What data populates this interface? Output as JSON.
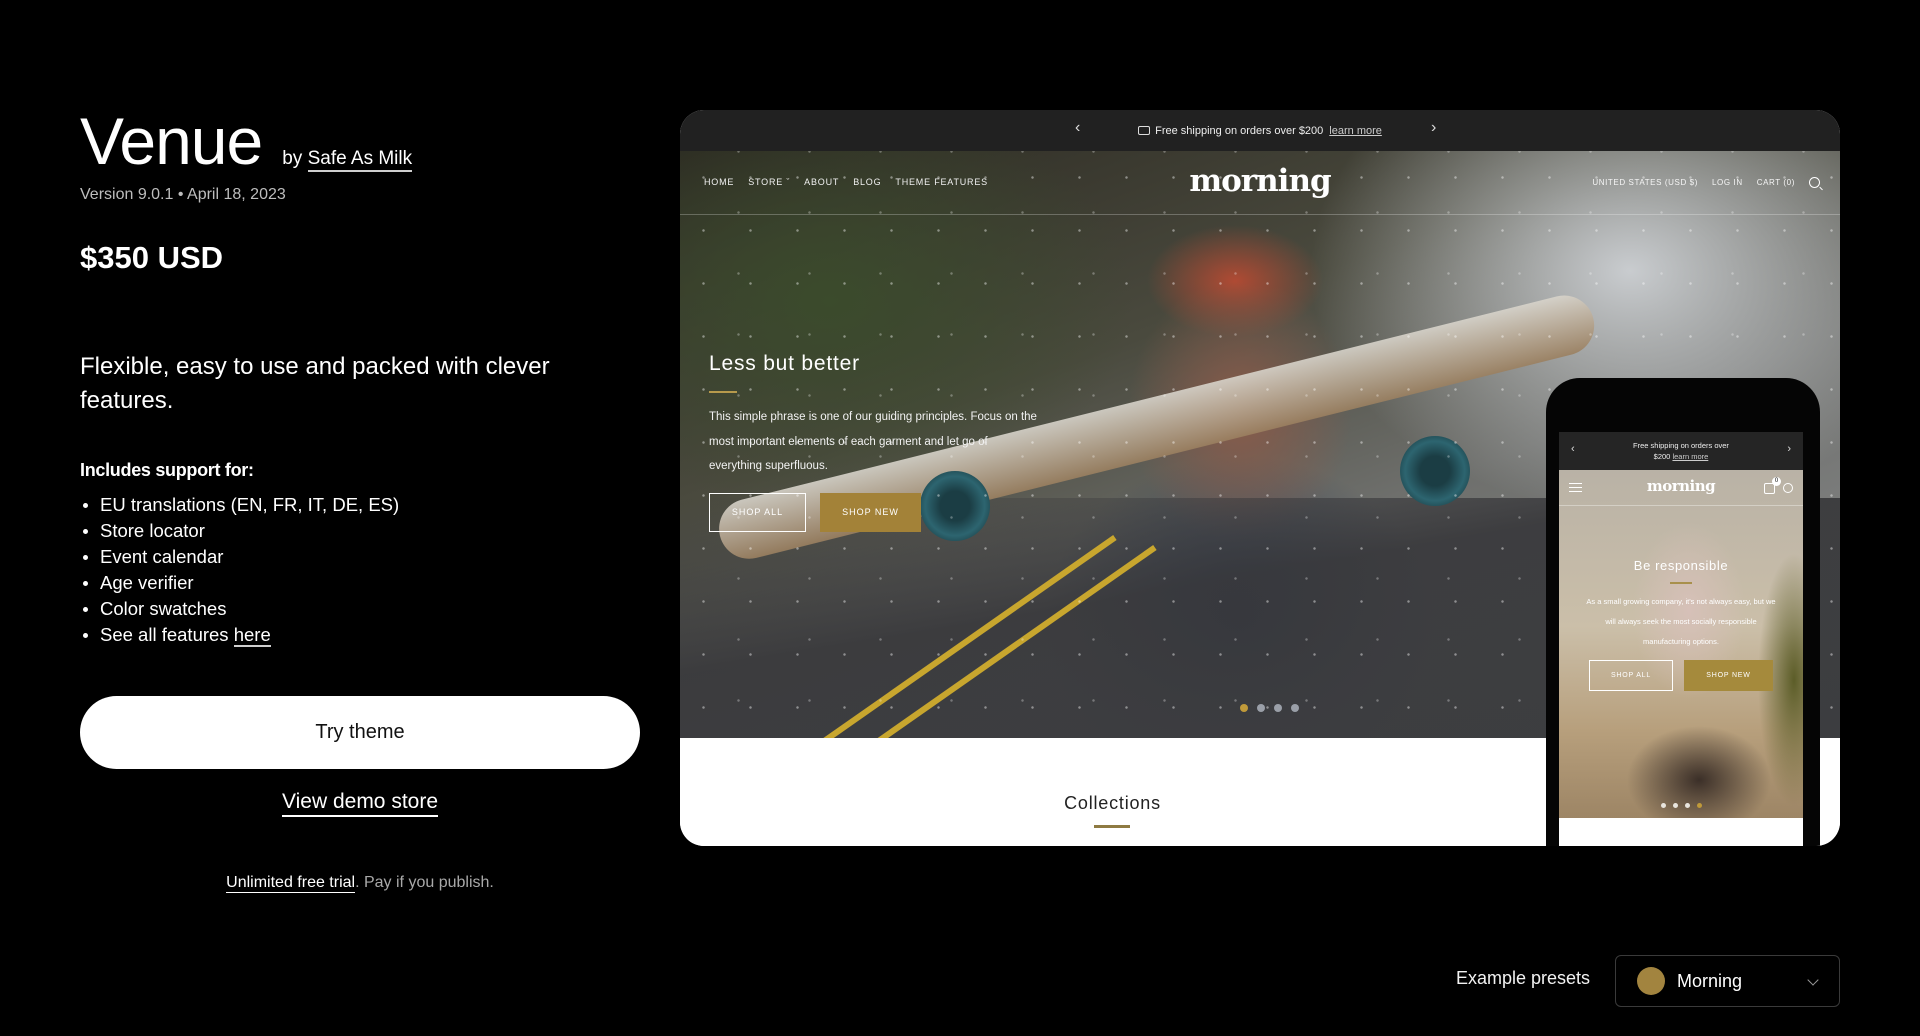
{
  "theme": {
    "name": "Venue",
    "by_prefix": "by",
    "author": "Safe As Milk",
    "version": "Version 9.0.1",
    "separator": "•",
    "date": "April 18, 2023",
    "price": "$350 USD",
    "tagline": "Flexible, easy to use and packed with clever features.",
    "includes_title": "Includes support for:",
    "features": [
      "EU translations (EN, FR, IT, DE, ES)",
      "Store locator",
      "Event calendar",
      "Age verifier",
      "Color swatches"
    ],
    "see_all_prefix": "See all features",
    "see_all_link": "here"
  },
  "actions": {
    "try_theme": "Try theme",
    "view_demo": "View demo store",
    "trial_link": "Unlimited free trial",
    "trial_rest": ". Pay if you publish."
  },
  "preview": {
    "announcement": "Free shipping on orders over $200",
    "announcement_link": "learn more",
    "nav_left": [
      "HOME",
      "STORE",
      "ABOUT",
      "BLOG",
      "THEME FEATURES"
    ],
    "logo": "morning",
    "nav_right": [
      "UNITED STATES (USD $)",
      "LOG IN",
      "CART (0)"
    ],
    "hero_title": "Less but better",
    "hero_text": "This simple phrase is one of our guiding principles. Focus on the most important elements of each garment and let go of everything superfluous.",
    "btn_shop_all": "SHOP ALL",
    "btn_shop_new": "SHOP NEW",
    "slides_total": 4,
    "slide_active": 1,
    "collections_title": "Collections",
    "accent_color": "#a38238"
  },
  "mobile_preview": {
    "announcement_line1": "Free shipping on orders over",
    "announcement_line2": "$200",
    "announcement_link": "learn more",
    "logo": "morning",
    "cart_count": "0",
    "hero_title": "Be responsible",
    "hero_text": "As a small growing company, it's not always easy, but we will always seek the most socially responsible manufacturing options.",
    "btn_shop_all": "SHOP ALL",
    "btn_shop_new": "SHOP NEW",
    "slides_total": 4,
    "slide_active": 4
  },
  "presets": {
    "label": "Example presets",
    "selected": "Morning",
    "swatch_color": "#a2843f"
  }
}
